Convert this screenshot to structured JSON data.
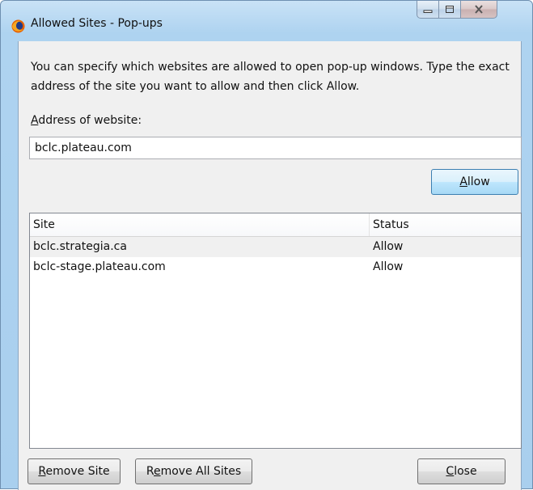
{
  "window": {
    "title": "Allowed Sites - Pop-ups"
  },
  "dialog": {
    "description": "You can specify which websites are allowed to open pop-up windows. Type the exact address of the site you want to allow and then click Allow.",
    "address_label_first": "A",
    "address_label_rest": "ddress of website:",
    "address_value": "bclc.plateau.com"
  },
  "buttons": {
    "allow_first": "A",
    "allow_rest": "llow",
    "remove_site_first": "R",
    "remove_site_rest": "emove Site",
    "remove_all_pre": "R",
    "remove_all_u": "e",
    "remove_all_rest": "move All Sites",
    "close_first": "C",
    "close_rest": "lose"
  },
  "table": {
    "columns": [
      "Site",
      "Status"
    ],
    "rows": [
      {
        "site": "bclc.strategia.ca",
        "status": "Allow"
      },
      {
        "site": "bclc-stage.plateau.com",
        "status": "Allow"
      }
    ]
  }
}
